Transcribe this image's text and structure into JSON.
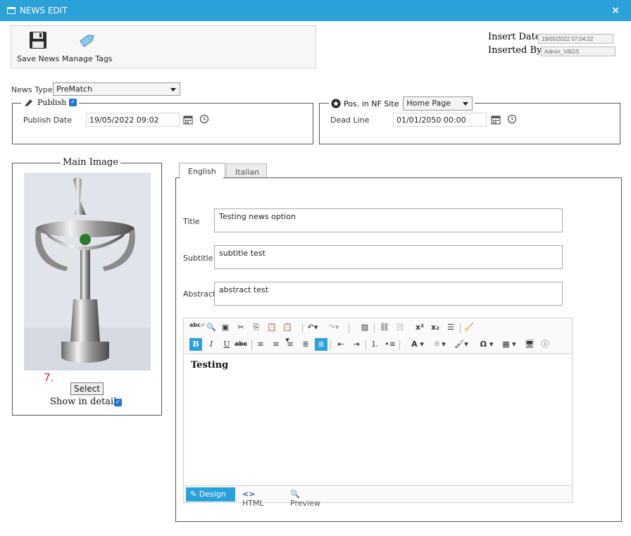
{
  "window": {
    "title": "NEWS EDIT",
    "close_label": "×"
  },
  "toolbar": {
    "save_label": "Save News",
    "tags_label": "Manage Tags"
  },
  "meta": {
    "insert_date_label": "Insert Date:",
    "insert_date_value": "19/05/2022 07:04:22",
    "inserted_by_label": "Inserted By:",
    "inserted_by_value": "Admin_ViliGS"
  },
  "news_type": {
    "label": "News Type",
    "value": "PreMatch"
  },
  "publish": {
    "legend": "Publish",
    "checked": true,
    "date_label": "Publish Date",
    "date_value": "19/05/2022 09:02"
  },
  "position": {
    "legend": "Pos. in NF Site",
    "value": "Home Page",
    "deadline_label": "Dead Line",
    "deadline_value": "01/01/2050 00:00"
  },
  "main_image": {
    "legend": "Main Image",
    "index_text": "7.",
    "select_label": "Select",
    "show_detail_label": "Show in detail",
    "show_detail_checked": true
  },
  "tabs": [
    {
      "label": "English",
      "active": true
    },
    {
      "label": "Italian",
      "active": false
    }
  ],
  "form": {
    "title_label": "Title",
    "title_value": "Testing news option",
    "subtitle_label": "Subtitle",
    "subtitle_value": "subtitle test",
    "abstract_label": "Abstract",
    "abstract_value": "abstract test"
  },
  "editor": {
    "content": "Testing",
    "modes": {
      "design": "Design",
      "html": "HTML",
      "preview": "Preview"
    },
    "active_mode": "Design"
  },
  "colors": {
    "accent": "#2ba1d9",
    "checkbox": "#1e73d6",
    "index_red": "#d9221c"
  }
}
